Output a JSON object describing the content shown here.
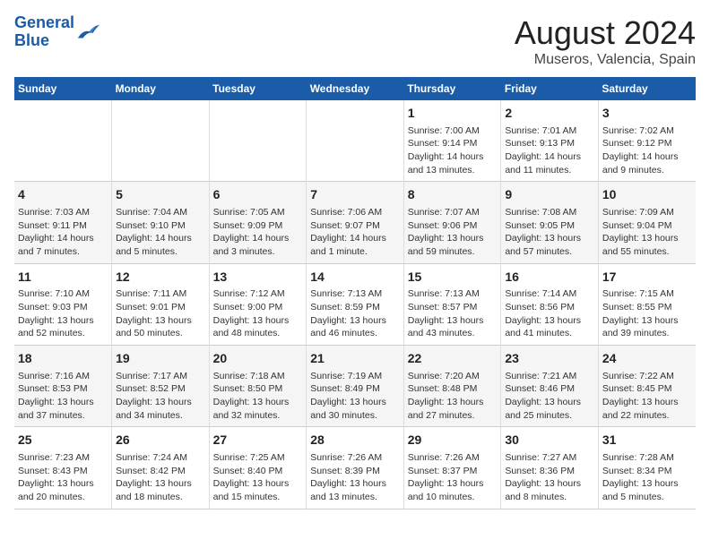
{
  "header": {
    "logo_line1": "General",
    "logo_line2": "Blue",
    "title": "August 2024",
    "subtitle": "Museros, Valencia, Spain"
  },
  "days_of_week": [
    "Sunday",
    "Monday",
    "Tuesday",
    "Wednesday",
    "Thursday",
    "Friday",
    "Saturday"
  ],
  "weeks": [
    [
      {
        "day": "",
        "info": ""
      },
      {
        "day": "",
        "info": ""
      },
      {
        "day": "",
        "info": ""
      },
      {
        "day": "",
        "info": ""
      },
      {
        "day": "1",
        "info": "Sunrise: 7:00 AM\nSunset: 9:14 PM\nDaylight: 14 hours and 13 minutes."
      },
      {
        "day": "2",
        "info": "Sunrise: 7:01 AM\nSunset: 9:13 PM\nDaylight: 14 hours and 11 minutes."
      },
      {
        "day": "3",
        "info": "Sunrise: 7:02 AM\nSunset: 9:12 PM\nDaylight: 14 hours and 9 minutes."
      }
    ],
    [
      {
        "day": "4",
        "info": "Sunrise: 7:03 AM\nSunset: 9:11 PM\nDaylight: 14 hours and 7 minutes."
      },
      {
        "day": "5",
        "info": "Sunrise: 7:04 AM\nSunset: 9:10 PM\nDaylight: 14 hours and 5 minutes."
      },
      {
        "day": "6",
        "info": "Sunrise: 7:05 AM\nSunset: 9:09 PM\nDaylight: 14 hours and 3 minutes."
      },
      {
        "day": "7",
        "info": "Sunrise: 7:06 AM\nSunset: 9:07 PM\nDaylight: 14 hours and 1 minute."
      },
      {
        "day": "8",
        "info": "Sunrise: 7:07 AM\nSunset: 9:06 PM\nDaylight: 13 hours and 59 minutes."
      },
      {
        "day": "9",
        "info": "Sunrise: 7:08 AM\nSunset: 9:05 PM\nDaylight: 13 hours and 57 minutes."
      },
      {
        "day": "10",
        "info": "Sunrise: 7:09 AM\nSunset: 9:04 PM\nDaylight: 13 hours and 55 minutes."
      }
    ],
    [
      {
        "day": "11",
        "info": "Sunrise: 7:10 AM\nSunset: 9:03 PM\nDaylight: 13 hours and 52 minutes."
      },
      {
        "day": "12",
        "info": "Sunrise: 7:11 AM\nSunset: 9:01 PM\nDaylight: 13 hours and 50 minutes."
      },
      {
        "day": "13",
        "info": "Sunrise: 7:12 AM\nSunset: 9:00 PM\nDaylight: 13 hours and 48 minutes."
      },
      {
        "day": "14",
        "info": "Sunrise: 7:13 AM\nSunset: 8:59 PM\nDaylight: 13 hours and 46 minutes."
      },
      {
        "day": "15",
        "info": "Sunrise: 7:13 AM\nSunset: 8:57 PM\nDaylight: 13 hours and 43 minutes."
      },
      {
        "day": "16",
        "info": "Sunrise: 7:14 AM\nSunset: 8:56 PM\nDaylight: 13 hours and 41 minutes."
      },
      {
        "day": "17",
        "info": "Sunrise: 7:15 AM\nSunset: 8:55 PM\nDaylight: 13 hours and 39 minutes."
      }
    ],
    [
      {
        "day": "18",
        "info": "Sunrise: 7:16 AM\nSunset: 8:53 PM\nDaylight: 13 hours and 37 minutes."
      },
      {
        "day": "19",
        "info": "Sunrise: 7:17 AM\nSunset: 8:52 PM\nDaylight: 13 hours and 34 minutes."
      },
      {
        "day": "20",
        "info": "Sunrise: 7:18 AM\nSunset: 8:50 PM\nDaylight: 13 hours and 32 minutes."
      },
      {
        "day": "21",
        "info": "Sunrise: 7:19 AM\nSunset: 8:49 PM\nDaylight: 13 hours and 30 minutes."
      },
      {
        "day": "22",
        "info": "Sunrise: 7:20 AM\nSunset: 8:48 PM\nDaylight: 13 hours and 27 minutes."
      },
      {
        "day": "23",
        "info": "Sunrise: 7:21 AM\nSunset: 8:46 PM\nDaylight: 13 hours and 25 minutes."
      },
      {
        "day": "24",
        "info": "Sunrise: 7:22 AM\nSunset: 8:45 PM\nDaylight: 13 hours and 22 minutes."
      }
    ],
    [
      {
        "day": "25",
        "info": "Sunrise: 7:23 AM\nSunset: 8:43 PM\nDaylight: 13 hours and 20 minutes."
      },
      {
        "day": "26",
        "info": "Sunrise: 7:24 AM\nSunset: 8:42 PM\nDaylight: 13 hours and 18 minutes."
      },
      {
        "day": "27",
        "info": "Sunrise: 7:25 AM\nSunset: 8:40 PM\nDaylight: 13 hours and 15 minutes."
      },
      {
        "day": "28",
        "info": "Sunrise: 7:26 AM\nSunset: 8:39 PM\nDaylight: 13 hours and 13 minutes."
      },
      {
        "day": "29",
        "info": "Sunrise: 7:26 AM\nSunset: 8:37 PM\nDaylight: 13 hours and 10 minutes."
      },
      {
        "day": "30",
        "info": "Sunrise: 7:27 AM\nSunset: 8:36 PM\nDaylight: 13 hours and 8 minutes."
      },
      {
        "day": "31",
        "info": "Sunrise: 7:28 AM\nSunset: 8:34 PM\nDaylight: 13 hours and 5 minutes."
      }
    ]
  ],
  "colors": {
    "header_bg": "#1a5ca8",
    "header_text": "#ffffff",
    "logo_blue": "#1a5ca8"
  }
}
